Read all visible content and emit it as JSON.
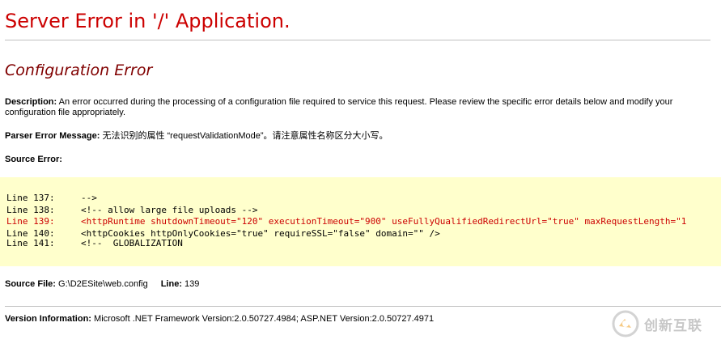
{
  "header": {
    "title": "Server Error in '/' Application.",
    "subtitle": "Configuration Error"
  },
  "description": {
    "label": "Description:",
    "text": "An error occurred during the processing of a configuration file required to service this request. Please review the specific error details below and modify your configuration file appropriately."
  },
  "parser": {
    "label": "Parser Error Message:",
    "text": "无法识别的属性 “requestValidationMode”。请注意属性名称区分大小写。"
  },
  "source_error": {
    "label": "Source Error:",
    "lines": [
      {
        "num": "Line 137:",
        "code": "-->",
        "highlight": false
      },
      {
        "num": "Line 138:",
        "code": "<!-- allow large file uploads -->",
        "highlight": false
      },
      {
        "num": "Line 139:",
        "code": "<httpRuntime shutdownTimeout=\"120\" executionTimeout=\"900\" useFullyQualifiedRedirectUrl=\"true\" maxRequestLength=\"1",
        "highlight": true
      },
      {
        "num": "Line 140:",
        "code": "<httpCookies httpOnlyCookies=\"true\" requireSSL=\"false\" domain=\"\" />",
        "highlight": false
      },
      {
        "num": "Line 141:",
        "code": "<!--  GLOBALIZATION",
        "highlight": false
      }
    ]
  },
  "source_file": {
    "label": "Source File:",
    "path": "G:\\D2ESite\\web.config",
    "line_label": "Line:",
    "line_value": "139"
  },
  "version": {
    "label": "Version Information:",
    "text": "Microsoft .NET Framework Version:2.0.50727.4984; ASP.NET Version:2.0.50727.4971"
  },
  "watermark": {
    "text": "创新互联",
    "icon": "watermark-logo-icon"
  },
  "colors": {
    "title": "#cc0000",
    "subtitle": "#800000",
    "code_background": "#ffffcc",
    "error_line": "#cc0000"
  }
}
